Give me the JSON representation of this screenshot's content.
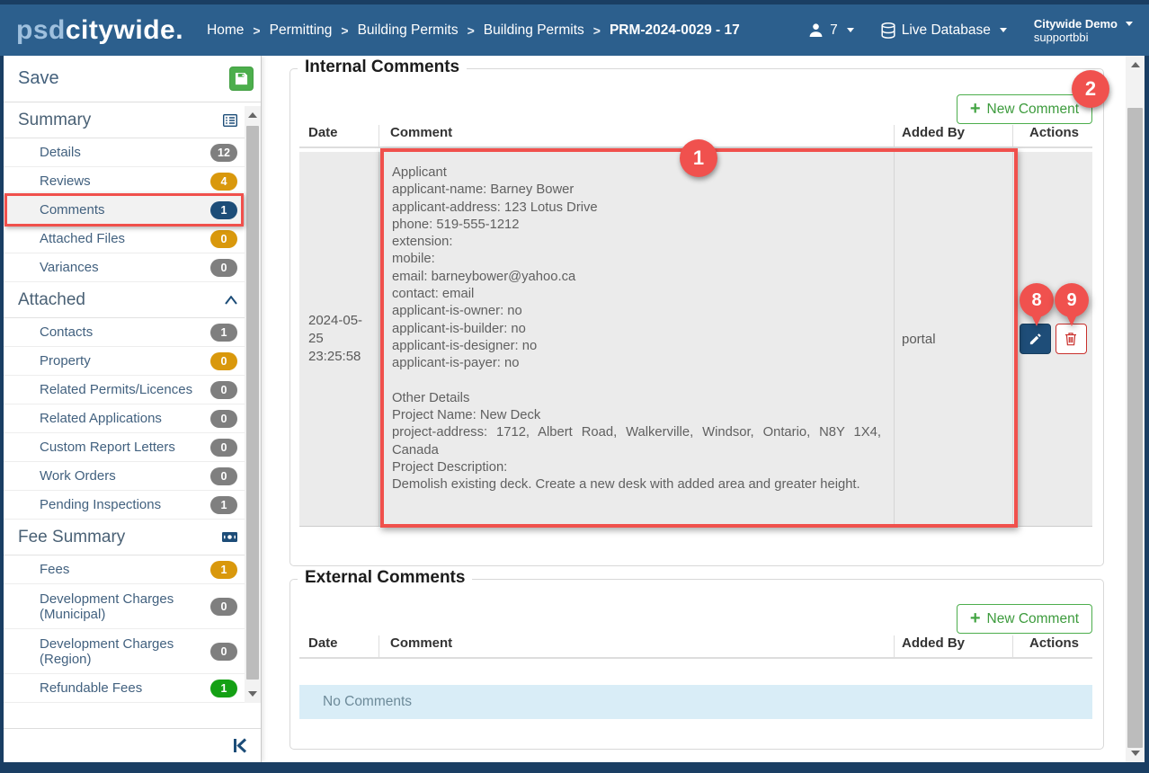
{
  "navbar": {
    "logo": {
      "part1": "psd",
      "part2": "citywide."
    },
    "separator": ">",
    "breadcrumbs": [
      {
        "label": "Home"
      },
      {
        "label": "Permitting"
      },
      {
        "label": "Building Permits"
      },
      {
        "label": "Building Permits"
      },
      {
        "label": "PRM-2024-0029 - 17"
      }
    ],
    "users_count": "7",
    "database_label": "Live Database",
    "account_name": "Citywide Demo",
    "account_user": "supportbbi"
  },
  "sidebar": {
    "save_label": "Save",
    "sections": [
      {
        "label": "Summary",
        "items": [
          {
            "label": "Details",
            "badge": "12"
          },
          {
            "label": "Reviews",
            "badge": "4"
          },
          {
            "label": "Comments",
            "badge": "1"
          },
          {
            "label": "Attached Files",
            "badge": "0"
          },
          {
            "label": "Variances",
            "badge": "0"
          }
        ]
      },
      {
        "label": "Attached",
        "items": [
          {
            "label": "Contacts",
            "badge": "1"
          },
          {
            "label": "Property",
            "badge": "0"
          },
          {
            "label": "Related Permits/Licences",
            "badge": "0"
          },
          {
            "label": "Related Applications",
            "badge": "0"
          },
          {
            "label": "Custom Report Letters",
            "badge": "0"
          },
          {
            "label": "Work Orders",
            "badge": "0"
          },
          {
            "label": "Pending Inspections",
            "badge": "1"
          }
        ]
      },
      {
        "label": "Fee Summary",
        "items": [
          {
            "label": "Fees",
            "badge": "1"
          },
          {
            "label": "Development Charges (Municipal)",
            "badge": "0"
          },
          {
            "label": "Development Charges (Region)",
            "badge": "0"
          },
          {
            "label": "Refundable Fees",
            "badge": "1"
          }
        ]
      }
    ]
  },
  "internal_comments": {
    "title": "Internal Comments",
    "new_comment_label": "New Comment",
    "columns": [
      "Date",
      "Comment",
      "Added By",
      "Actions"
    ],
    "rows": [
      {
        "date": "2024-05-25 23:25:58",
        "comment": "Applicant\napplicant-name: Barney Bower\napplicant-address: 123 Lotus Drive\nphone: 519-555-1212\nextension:\nmobile:\nemail: barneybower@yahoo.ca\ncontact: email\napplicant-is-owner: no\napplicant-is-builder: no\napplicant-is-designer: no\napplicant-is-payer: no\n\nOther Details\nProject Name: New Deck\nproject-address: 1712, Albert Road, Walkerville, Windsor, Ontario, N8Y 1X4, Canada\nProject Description:\nDemolish existing deck. Create a new desk with added area and greater height.",
        "added_by": "portal"
      }
    ]
  },
  "external_comments": {
    "title": "External Comments",
    "new_comment_label": "New Comment",
    "columns": [
      "Date",
      "Comment",
      "Added By",
      "Actions"
    ],
    "empty_message": "No Comments"
  },
  "annotations": {
    "comment_area": "1",
    "new_comment": "2",
    "edit": "8",
    "delete": "9"
  },
  "colors": {
    "navbar_bg": "#2c5f8d",
    "window_border": "#1a3e63",
    "annotation_red": "#f0514e",
    "badge_gray": "#7f7f7f",
    "badge_orange": "#d9980c",
    "badge_navy": "#1d4d78",
    "badge_green": "#14a014",
    "button_green": "#4cae4c",
    "edit_button_navy": "#1e4d78",
    "delete_button_red": "#c9302c",
    "empty_row_blue": "#d9edf7"
  }
}
